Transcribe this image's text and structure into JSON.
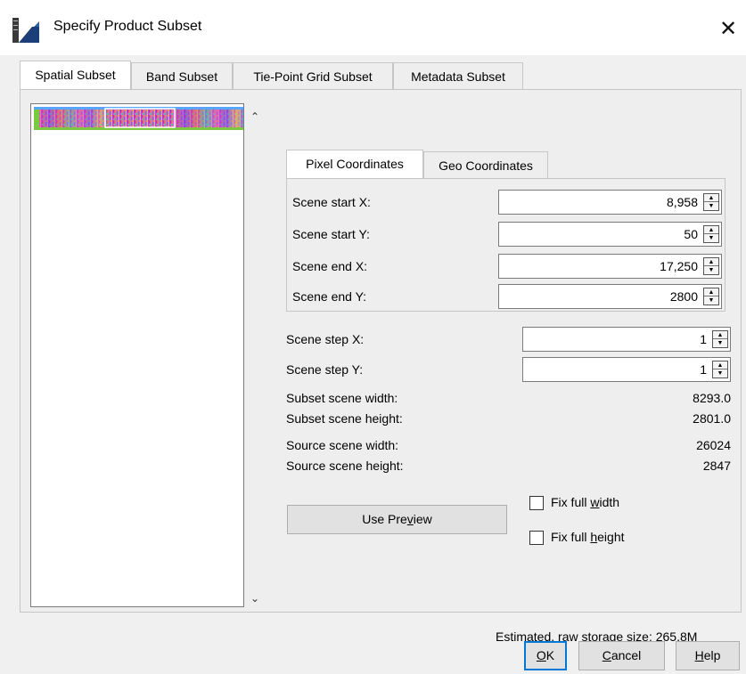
{
  "window": {
    "title": "Specify Product Subset",
    "close_glyph": "✕",
    "icon": "snap-app-icon"
  },
  "tabs": [
    {
      "label": "Spatial Subset",
      "active": true
    },
    {
      "label": "Band Subset",
      "active": false
    },
    {
      "label": "Tie-Point Grid Subset",
      "active": false
    },
    {
      "label": "Metadata Subset",
      "active": false
    }
  ],
  "preview": {
    "scroll_up": "⌃",
    "scroll_down": "⌄"
  },
  "coord_tabs": [
    {
      "label": "Pixel Coordinates",
      "active": true
    },
    {
      "label": "Geo Coordinates",
      "active": false
    }
  ],
  "fields": {
    "scene_start_x": {
      "label": "Scene start X:",
      "value": "8,958"
    },
    "scene_start_y": {
      "label": "Scene start Y:",
      "value": "50"
    },
    "scene_end_x": {
      "label": "Scene end X:",
      "value": "17,250"
    },
    "scene_end_y": {
      "label": "Scene end Y:",
      "value": "2800"
    },
    "scene_step_x": {
      "label": "Scene step X:",
      "value": "1"
    },
    "scene_step_y": {
      "label": "Scene step Y:",
      "value": "1"
    }
  },
  "info": {
    "subset_width": {
      "label": "Subset scene width:",
      "value": "8293.0"
    },
    "subset_height": {
      "label": "Subset scene height:",
      "value": "2801.0"
    },
    "source_width": {
      "label": "Source scene width:",
      "value": "26024"
    },
    "source_height": {
      "label": "Source scene height:",
      "value": "2847"
    }
  },
  "use_preview": {
    "label_pre": "Use Pre",
    "label_u": "v",
    "label_post": "iew"
  },
  "fix_full_width": {
    "pre": "Fix full ",
    "u": "w",
    "post": "idth",
    "checked": false
  },
  "fix_full_height": {
    "pre": "Fix full ",
    "u": "h",
    "post": "eight",
    "checked": false
  },
  "estimate": "Estimated, raw storage size: 265.8M",
  "buttons": {
    "ok": {
      "u": "O",
      "post": "K"
    },
    "cancel": {
      "u": "C",
      "post": "ancel"
    },
    "help": {
      "u": "H",
      "post": "elp"
    }
  },
  "colors": {
    "accent": "#0078d7",
    "field_border": "#7a7a7a",
    "panel_bg": "#eeeeee"
  }
}
